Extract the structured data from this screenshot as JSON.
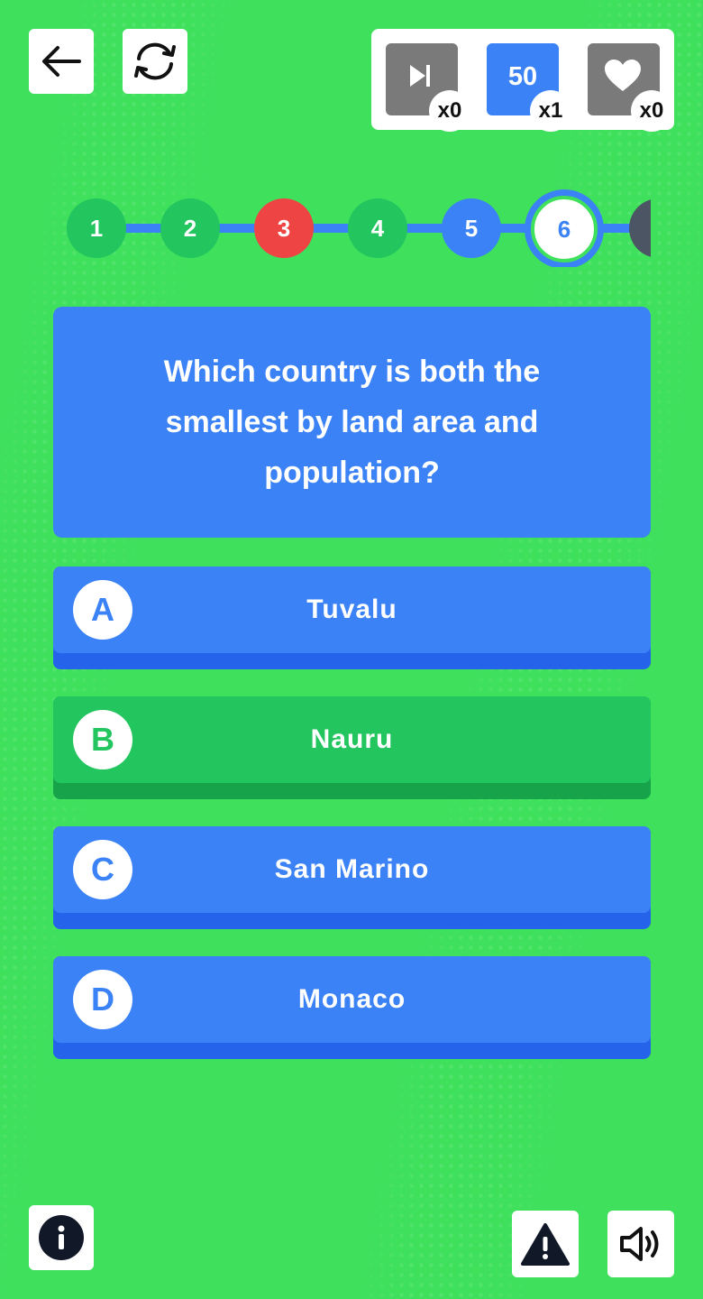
{
  "toolbar": {
    "back_icon": "arrow-left-icon",
    "refresh_icon": "refresh-icon"
  },
  "powerups": [
    {
      "name": "skip",
      "icon": "skip-next-icon",
      "count": "x0"
    },
    {
      "name": "fifty",
      "label": "50",
      "count": "x1"
    },
    {
      "name": "extra-life",
      "icon": "heart-icon",
      "count": "x0"
    }
  ],
  "progress": {
    "steps": [
      {
        "label": "1",
        "status": "correct"
      },
      {
        "label": "2",
        "status": "correct"
      },
      {
        "label": "3",
        "status": "wrong"
      },
      {
        "label": "4",
        "status": "correct"
      },
      {
        "label": "5",
        "status": "answered"
      },
      {
        "label": "6",
        "status": "current"
      },
      {
        "label": "",
        "status": "upcoming"
      }
    ]
  },
  "question": {
    "text": "Which country is both the smallest by land area and population?"
  },
  "answers": [
    {
      "letter": "A",
      "text": "Tuvalu",
      "state": "default"
    },
    {
      "letter": "B",
      "text": "Nauru",
      "state": "correct"
    },
    {
      "letter": "C",
      "text": "San Marino",
      "state": "default"
    },
    {
      "letter": "D",
      "text": "Monaco",
      "state": "default"
    }
  ],
  "footer": {
    "info_icon": "info-icon",
    "report_icon": "warning-icon",
    "sound_icon": "speaker-icon"
  },
  "colors": {
    "background": "#3fe05c",
    "primary": "#3b82f6",
    "correct": "#22c55e",
    "wrong": "#ef4444"
  }
}
